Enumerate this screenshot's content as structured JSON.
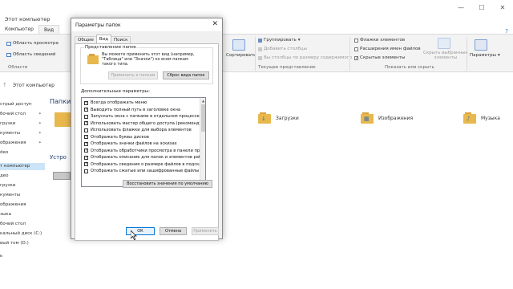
{
  "window": {
    "title": "Этот компьютер",
    "controls": [
      "—",
      "☐",
      "✕"
    ]
  },
  "ribbon_tabs": [
    "Компьютер",
    "Вид"
  ],
  "ribbon_active": "Вид",
  "help_icon": "?",
  "ribbon": {
    "nav_pane_items": [
      "Область просмотра",
      "Область сведений"
    ],
    "areas_label": "Области",
    "sort_label": "Сортировать",
    "group_label": "Группировать",
    "add_cols_label": "Добавить столбцы",
    "fit_cols_label": "Вы столбцы по размеру содержимого",
    "current_view_label": "Текущее представление",
    "chk_item_flags": "Флажки элементов",
    "chk_extensions": "Расширения имен файлов",
    "chk_hidden": "Скрытые элементы",
    "hide_selected": [
      "Скрыть выбранные",
      "элементы"
    ],
    "show_hide_label": "Показать или скрыть",
    "params_label": "Параметры"
  },
  "address": {
    "path": "Этот компьютер"
  },
  "sidebar": {
    "items": [
      {
        "label": "стрый доступ"
      },
      {
        "label": "бочий стол"
      },
      {
        "label": "грузки"
      },
      {
        "label": "кументы"
      },
      {
        "label": "ображения"
      },
      {
        "label": "deo"
      },
      {
        "label": "т компьютер",
        "selected": true
      },
      {
        "label": "део"
      },
      {
        "label": "грузки"
      },
      {
        "label": "кументы"
      },
      {
        "label": "ображения"
      },
      {
        "label": "зыка"
      },
      {
        "label": "бочий стол"
      },
      {
        "label": "кальный диск (C:)"
      },
      {
        "label": "вый том (D:)"
      },
      {
        "label": "ь"
      }
    ]
  },
  "main": {
    "section_folders": "Папки",
    "section_devices": "Устро",
    "folders": [
      {
        "name": "Загрузки",
        "glyph": "↓"
      },
      {
        "name": "Изображения",
        "glyph": "▦"
      },
      {
        "name": "Музыка",
        "glyph": "♪"
      }
    ]
  },
  "dialog": {
    "title": "Параметры папок",
    "close_glyph": "✕",
    "tabs": [
      "Общие",
      "Вид",
      "Поиск"
    ],
    "active_tab": "Вид",
    "folder_view_group": "Представление папок",
    "folder_view_text": "Вы можете применить этот вид (например, \"Таблица\" или \"Значки\") ко всем папкам такого типа.",
    "apply_to_folders": "Применить к папкам",
    "reset_folders": "Сброс вида папок",
    "advanced_label": "Дополнительные параметры:",
    "advanced_items": [
      {
        "label": "Всегда отображать меню",
        "checked": true
      },
      {
        "label": "Выводить полный путь в заголовке окна",
        "checked": true
      },
      {
        "label": "Запускать окна с папками в отдельном процессе",
        "checked": false
      },
      {
        "label": "Использовать мастер общего доступа (рекомендует",
        "checked": true
      },
      {
        "label": "Использовать флажки для выбора элементов",
        "checked": false
      },
      {
        "label": "Отображать буквы дисков",
        "checked": true
      },
      {
        "label": "Отображать значки файлов на эскизах",
        "checked": true
      },
      {
        "label": "Отображать обработчики просмотра в панели просм",
        "checked": true
      },
      {
        "label": "Отображать описание для папок и элементов рабоч",
        "checked": true
      },
      {
        "label": "Отображать сведения о размере файлов в подсказк",
        "checked": true
      },
      {
        "label": "Отображать сжатые или зашифрованные файлы NTF",
        "checked": false
      }
    ],
    "restore_defaults": "Восстановить значения по умолчанию",
    "ok": "ОК",
    "cancel": "Отмена",
    "apply": "Применить"
  }
}
